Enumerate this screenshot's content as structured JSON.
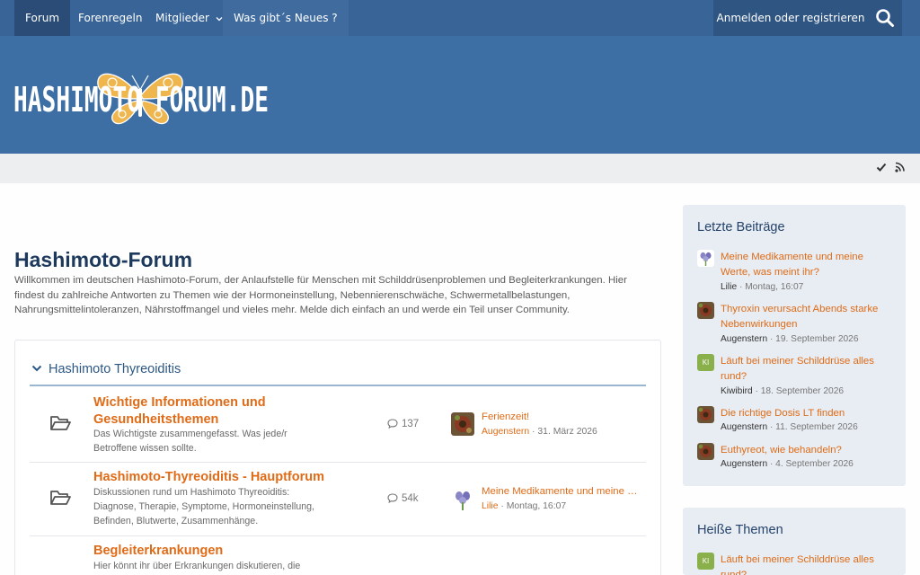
{
  "nav": {
    "items": [
      "Forum",
      "Forenregeln",
      "Mitglieder",
      "Was gibt´s Neues ?"
    ],
    "login": "Anmelden oder registrieren"
  },
  "logo": {
    "text": "HASHIMOTO FORUM.DE"
  },
  "main": {
    "title": "Hashimoto-Forum",
    "description": "Willkommen im deutschen Hashimoto-Forum, der Anlaufstelle für Menschen mit Schilddrüsenproblemen und Begleiterkrankungen. Hier findest du zahlreiche Antworten zu Themen wie der Hormoneinstellung, Nebennierenschwäche, Schwermetallbelastungen, Nahrungsmittelintoleranzen, Nährstoffmangel und vieles mehr. Melde dich einfach an und werde ein Teil unser Community."
  },
  "category": {
    "title": "Hashimoto Thyreoiditis",
    "nodes": [
      {
        "title": "Wichtige Informationen und Gesundheitsthemen",
        "desc": "Das Wichtigste zusammengefasst. Was jede/r Betroffene wissen sollte.",
        "count": "137",
        "last_title": "Ferienzeit!",
        "last_user": "Augenstern",
        "last_date": "31. März 2026"
      },
      {
        "title": "Hashimoto-Thyreoiditis - Hauptforum",
        "desc": "Diskussionen rund um Hashimoto Thyreoiditis: Diagnose, Therapie, Symptome, Hormoneinstellung, Befinden, Blutwerte, Zusammenhänge.",
        "count": "54k",
        "last_title": "Meine Medikamente und meine Werte, was meint ihr?",
        "last_user": "Lilie",
        "last_date": "Montag, 16:07"
      },
      {
        "title": "Begleiterkrankungen",
        "desc": "Hier könnt ihr über Erkrankungen diskutieren, die",
        "count": "",
        "last_title": "",
        "last_user": "",
        "last_date": ""
      }
    ]
  },
  "sidebar": {
    "latest_title": "Letzte Beiträge",
    "latest": [
      {
        "title": "Meine Medikamente und meine Werte, was meint ihr?",
        "user": "Lilie",
        "date": "Montag, 16:07",
        "avatar": "flower"
      },
      {
        "title": "Thyroxin verursacht Abends starke Nebenwirkungen",
        "user": "Augenstern",
        "date": "19. September 2026",
        "avatar": "photo"
      },
      {
        "title": "Läuft bei meiner Schilddrüse alles rund?",
        "user": "Kiwibird",
        "date": "18. September 2026",
        "avatar": "KI"
      },
      {
        "title": "Die richtige Dosis LT finden",
        "user": "Augenstern",
        "date": "11. September 2026",
        "avatar": "photo"
      },
      {
        "title": "Euthyreot, wie behandeln?",
        "user": "Augenstern",
        "date": "4. September 2026",
        "avatar": "photo"
      }
    ],
    "hot_title": "Heiße Themen",
    "hot": [
      {
        "title": "Läuft bei meiner Schilddrüse alles rund?",
        "avatar": "KI"
      }
    ]
  },
  "colors": {
    "nav": "#396497",
    "header": "#3d6ea4",
    "accent": "#df6b17",
    "title": "#1d3a5c"
  }
}
